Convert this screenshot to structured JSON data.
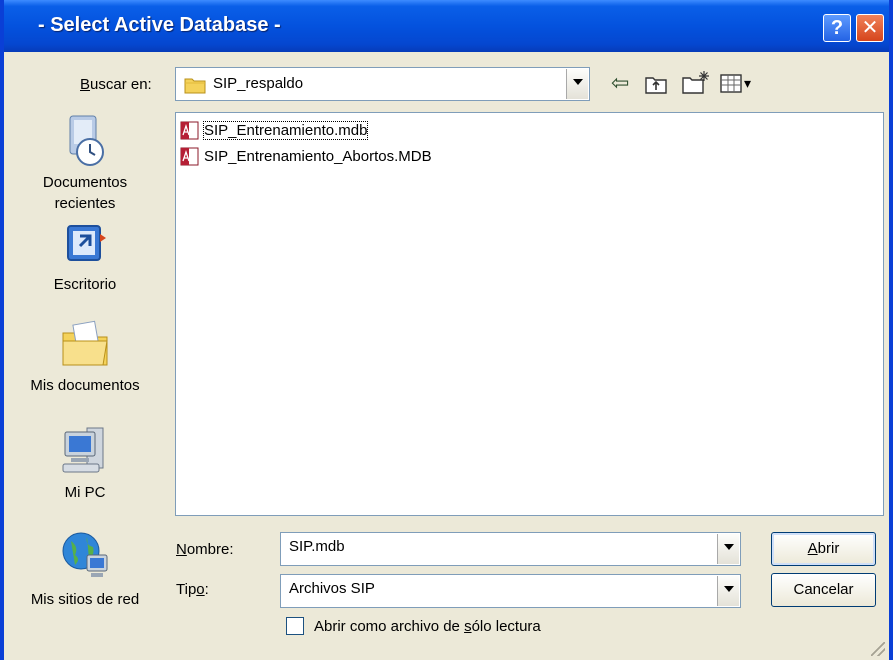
{
  "window": {
    "title": "- Select Active Database -",
    "help_glyph": "?",
    "close_glyph": "✕"
  },
  "look_in": {
    "label_accel": "B",
    "label_rest": "uscar en:",
    "value": "SIP_respaldo"
  },
  "toolbar": {
    "back_glyph": "⇦",
    "view_menu_glyph": "▾"
  },
  "places": [
    {
      "label_line1": "Documentos",
      "label_line2": "recientes",
      "icon": "recent-documents-icon"
    },
    {
      "label_line1": "Escritorio",
      "icon": "desktop-icon"
    },
    {
      "label_line1": "Mis documentos",
      "icon": "my-documents-icon"
    },
    {
      "label_line1": "Mi PC",
      "icon": "my-computer-icon"
    },
    {
      "label_line1": "Mis sitios de red",
      "icon": "network-places-icon"
    }
  ],
  "files": [
    {
      "name": "SIP_Entrenamiento.mdb",
      "selected": true
    },
    {
      "name": "SIP_Entrenamiento_Abortos.MDB",
      "selected": false
    }
  ],
  "filename": {
    "label_accel": "N",
    "label_rest": "ombre:",
    "value": "SIP.mdb"
  },
  "filetype": {
    "label_pre": "Tip",
    "label_accel": "o",
    "label_rest": ":",
    "value": "Archivos SIP"
  },
  "readonly": {
    "label_pre": "Abrir como archivo de ",
    "label_accel": "s",
    "label_rest": "ólo lectura",
    "checked": false
  },
  "buttons": {
    "open_accel": "A",
    "open_rest": "brir",
    "cancel": "Cancelar"
  },
  "colors": {
    "titlebar": "#0452de",
    "dialog_bg": "#ece9d8",
    "folder": "#f4d25a"
  }
}
